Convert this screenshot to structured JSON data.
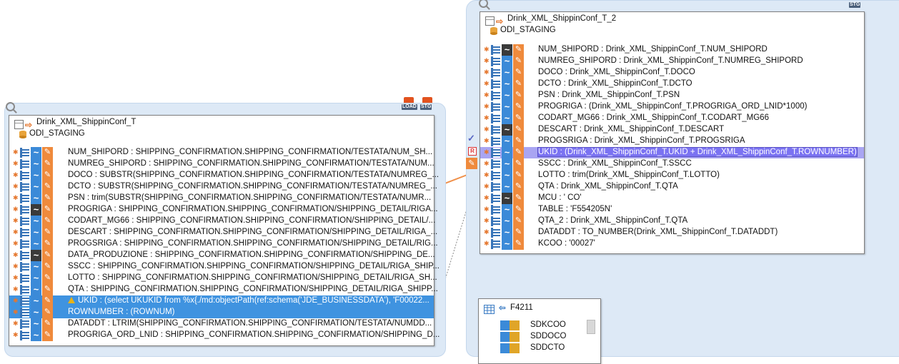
{
  "left_panel": {
    "title": "Drink_XML_ShippinConf_T",
    "schema": "ODI_STAGING",
    "badges": [
      "LOAD",
      "STG"
    ],
    "rows": [
      {
        "text": "NUM_SHIPORD : SHIPPING_CONFIRMATION.SHIPPING_CONFIRMATION/TESTATA/NUM_SH...",
        "dark": false
      },
      {
        "text": "NUMREG_SHIPORD : SHIPPING_CONFIRMATION.SHIPPING_CONFIRMATION/TESTATA/NUM...",
        "dark": false
      },
      {
        "text": "DOCO : SUBSTR(SHIPPING_CONFIRMATION.SHIPPING_CONFIRMATION/TESTATA/NUMREG_...",
        "dark": false
      },
      {
        "text": "DCTO : SUBSTR(SHIPPING_CONFIRMATION.SHIPPING_CONFIRMATION/TESTATA/NUMREG_...",
        "dark": false
      },
      {
        "text": "PSN : trim(SUBSTR(SHIPPING_CONFIRMATION.SHIPPING_CONFIRMATION/TESTATA/NUMR...",
        "dark": false
      },
      {
        "text": "PROGRIGA : SHIPPING_CONFIRMATION.SHIPPING_CONFIRMATION/SHIPPING_DETAIL/RIGA...",
        "dark": true
      },
      {
        "text": "CODART_MG66 : SHIPPING_CONFIRMATION.SHIPPING_CONFIRMATION/SHIPPING_DETAIL/...",
        "dark": false
      },
      {
        "text": "DESCART : SHIPPING_CONFIRMATION.SHIPPING_CONFIRMATION/SHIPPING_DETAIL/RIGA_...",
        "dark": false
      },
      {
        "text": "PROGSRIGA : SHIPPING_CONFIRMATION.SHIPPING_CONFIRMATION/SHIPPING_DETAIL/RIG...",
        "dark": false
      },
      {
        "text": "DATA_PRODUZIONE : SHIPPING_CONFIRMATION.SHIPPING_CONFIRMATION/SHIPPING_DE...",
        "dark": true
      },
      {
        "text": "SSCC : SHIPPING_CONFIRMATION.SHIPPING_CONFIRMATION/SHIPPING_DETAIL/RIGA_SHIP...",
        "dark": false
      },
      {
        "text": "LOTTO : SHIPPING_CONFIRMATION.SHIPPING_CONFIRMATION/SHIPPING_DETAIL/RIGA_SH...",
        "dark": false
      },
      {
        "text": "QTA : SHIPPING_CONFIRMATION.SHIPPING_CONFIRMATION/SHIPPING_DETAIL/RIGA_SHIPP...",
        "dark": false
      },
      {
        "text": "UKID : (select UKUKID from %x{./md:objectPath(ref:schema('JDE_BUSINESSDATA'), 'F00022...",
        "dark": false,
        "selected": true,
        "warn": true
      },
      {
        "text": "ROWNUMBER : (ROWNUM)",
        "dark": false,
        "selected": true
      },
      {
        "text": "DATADDT : LTRIM(SHIPPING_CONFIRMATION.SHIPPING_CONFIRMATION/TESTATA/NUMDD...",
        "dark": false
      },
      {
        "text": "PROGRIGA_ORD_LNID : SHIPPING_CONFIRMATION.SHIPPING_CONFIRMATION/SHIPPING_D...",
        "dark": false
      }
    ]
  },
  "right_panel": {
    "title": "Drink_XML_ShippinConf_T_2",
    "schema": "ODI_STAGING",
    "badges": [
      "STG"
    ],
    "rows": [
      {
        "text": "NUM_SHIPORD : Drink_XML_ShippinConf_T.NUM_SHIPORD",
        "dark": true
      },
      {
        "text": "NUMREG_SHIPORD : Drink_XML_ShippinConf_T.NUMREG_SHIPORD",
        "dark": false
      },
      {
        "text": "DOCO : Drink_XML_ShippinConf_T.DOCO",
        "dark": false
      },
      {
        "text": "DCTO : Drink_XML_ShippinConf_T.DCTO",
        "dark": false
      },
      {
        "text": "PSN : Drink_XML_ShippinConf_T.PSN",
        "dark": false
      },
      {
        "text": "PROGRIGA : (Drink_XML_ShippinConf_T.PROGRIGA_ORD_LNID*1000)",
        "dark": false
      },
      {
        "text": "CODART_MG66 : Drink_XML_ShippinConf_T.CODART_MG66",
        "dark": false
      },
      {
        "text": "DESCART : Drink_XML_ShippinConf_T.DESCART",
        "dark": true
      },
      {
        "text": "PROGSRIGA : Drink_XML_ShippinConf_T.PROGSRIGA",
        "dark": false
      },
      {
        "text": "UKID : (Drink_XML_ShippinConf_T.UKID + Drink_XML_ShippinConf_T.ROWNUMBER)",
        "dark": false,
        "selected2": true
      },
      {
        "text": "SSCC : Drink_XML_ShippinConf_T.SSCC",
        "dark": false
      },
      {
        "text": "LOTTO : trim(Drink_XML_ShippinConf_T.LOTTO)",
        "dark": false
      },
      {
        "text": "QTA : Drink_XML_ShippinConf_T.QTA",
        "dark": false
      },
      {
        "text": "MCU : '          CO'",
        "dark": true
      },
      {
        "text": "TABLE : 'F554205N'",
        "dark": false
      },
      {
        "text": "QTA_2 : Drink_XML_ShippinConf_T.QTA",
        "dark": false
      },
      {
        "text": "DATADDT : TO_NUMBER(Drink_XML_ShippinConf_T.DATADDT)",
        "dark": false
      },
      {
        "text": "KCOO : '00027'",
        "dark": false
      }
    ]
  },
  "bottom_panel": {
    "title": "F4211",
    "rows": [
      "SDKCOO",
      "SDDOCO",
      "SDDCTO"
    ]
  },
  "colors": {
    "group_bg": "#dde9f6",
    "selected_row": "#3f93e0",
    "selected_row_alt": "#7b73f2",
    "mapping_line": "#5aa0e0",
    "flow_arrow": "#f0904a"
  }
}
